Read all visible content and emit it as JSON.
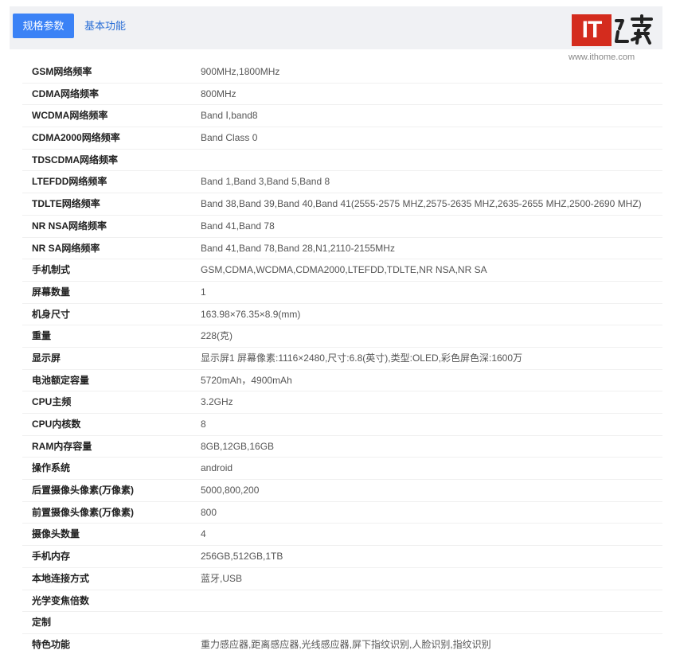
{
  "tabs": {
    "active_label": "规格参数",
    "other_label": "基本功能"
  },
  "logo": {
    "text": "IT之家",
    "box_text": "IT",
    "url": "www.ithome.com",
    "brand_color": "#d42c1e"
  },
  "colors": {
    "accent": "#3b82f6",
    "tab_bar_bg": "#f0f1f4",
    "link": "#2b6fd6"
  },
  "specs": [
    {
      "label": "GSM网络频率",
      "value": "900MHz,1800MHz"
    },
    {
      "label": "CDMA网络频率",
      "value": "800MHz"
    },
    {
      "label": "WCDMA网络频率",
      "value": "Band Ⅰ,band8"
    },
    {
      "label": "CDMA2000网络频率",
      "value": "Band Class 0"
    },
    {
      "label": "TDSCDMA网络频率",
      "value": ""
    },
    {
      "label": "LTEFDD网络频率",
      "value": "Band 1,Band 3,Band 5,Band 8"
    },
    {
      "label": "TDLTE网络频率",
      "value": "Band 38,Band 39,Band 40,Band 41(2555-2575 MHZ,2575-2635 MHZ,2635-2655 MHZ,2500-2690 MHZ)"
    },
    {
      "label": "NR NSA网络频率",
      "value": "Band 41,Band 78"
    },
    {
      "label": "NR SA网络频率",
      "value": "Band 41,Band 78,Band 28,N1,2110-2155MHz"
    },
    {
      "label": "手机制式",
      "value": "GSM,CDMA,WCDMA,CDMA2000,LTEFDD,TDLTE,NR NSA,NR SA"
    },
    {
      "label": "屏幕数量",
      "value": "1"
    },
    {
      "label": "机身尺寸",
      "value": "163.98×76.35×8.9(mm)"
    },
    {
      "label": "重量",
      "value": "228(克)"
    },
    {
      "label": "显示屏",
      "value": "显示屏1 屏幕像素:1116×2480,尺寸:6.8(英寸),类型:OLED,彩色屏色深:1600万"
    },
    {
      "label": "电池额定容量",
      "value": "5720mAh，4900mAh"
    },
    {
      "label": "CPU主频",
      "value": "3.2GHz"
    },
    {
      "label": "CPU内核数",
      "value": "8"
    },
    {
      "label": "RAM内存容量",
      "value": "8GB,12GB,16GB"
    },
    {
      "label": "操作系统",
      "value": "android"
    },
    {
      "label": "后置摄像头像素(万像素)",
      "value": "5000,800,200"
    },
    {
      "label": "前置摄像头像素(万像素)",
      "value": "800"
    },
    {
      "label": "摄像头数量",
      "value": "4"
    },
    {
      "label": "手机内存",
      "value": "256GB,512GB,1TB"
    },
    {
      "label": "本地连接方式",
      "value": "蓝牙,USB"
    },
    {
      "label": "光学变焦倍数",
      "value": ""
    },
    {
      "label": "定制",
      "value": ""
    },
    {
      "label": "特色功能",
      "value": "重力感应器,距离感应器,光线感应器,屏下指纹识别,人脸识别,指纹识别"
    }
  ]
}
